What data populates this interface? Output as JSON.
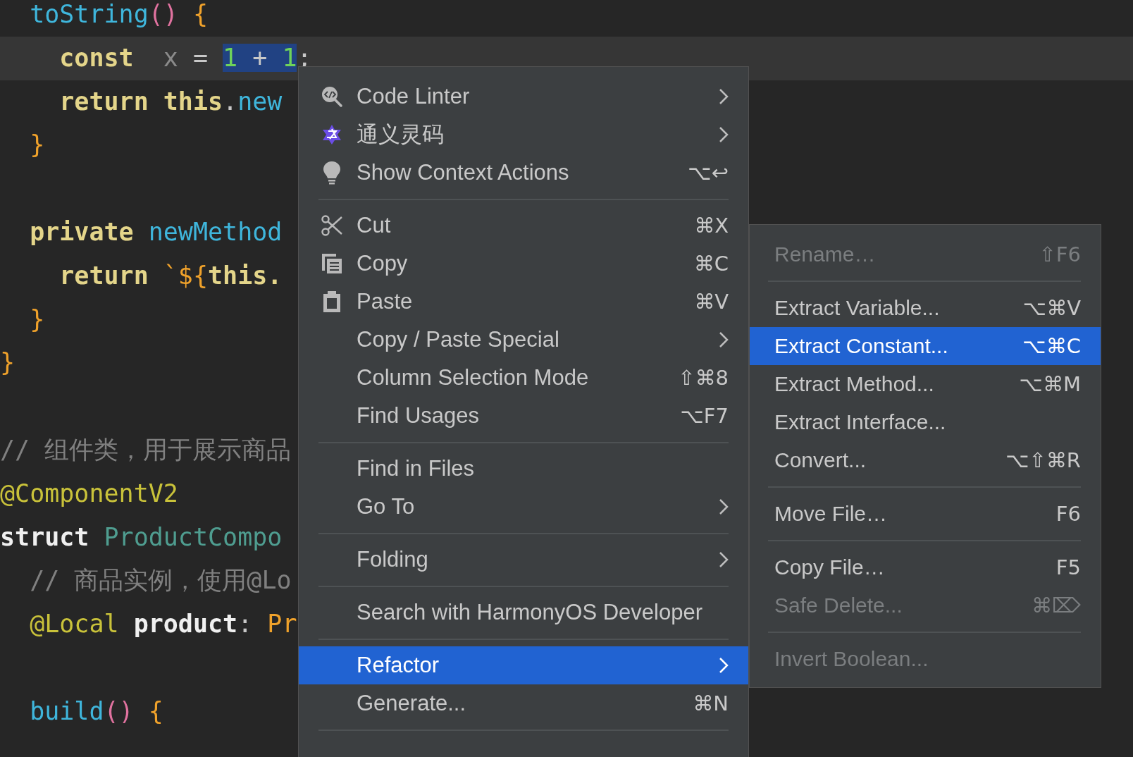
{
  "editor": {
    "lines": [
      {
        "current": false,
        "tokens": [
          {
            "text": "  toString",
            "kind": "function",
            "selected": false
          },
          {
            "text": "()",
            "kind": "paren",
            "selected": false
          },
          {
            "text": " {",
            "kind": "brace",
            "selected": false
          }
        ]
      },
      {
        "current": true,
        "tokens": [
          {
            "text": "    const",
            "kind": "keyword",
            "selected": false
          },
          {
            "text": "  x",
            "kind": "variable",
            "selected": false
          },
          {
            "text": " = ",
            "kind": "operator",
            "selected": false
          },
          {
            "text": "1",
            "kind": "number",
            "selected": true
          },
          {
            "text": " + ",
            "kind": "operator",
            "selected": true
          },
          {
            "text": "1",
            "kind": "number",
            "selected": true
          },
          {
            "text": ";",
            "kind": "operator",
            "selected": false
          }
        ]
      },
      {
        "current": false,
        "tokens": [
          {
            "text": "    return this",
            "kind": "keyword",
            "selected": false
          },
          {
            "text": ".",
            "kind": "operator",
            "selected": false
          },
          {
            "text": "new",
            "kind": "function",
            "selected": false
          }
        ]
      },
      {
        "current": false,
        "tokens": [
          {
            "text": "  }",
            "kind": "brace",
            "selected": false
          }
        ]
      },
      {
        "current": false
      },
      {
        "current": false,
        "tokens": [
          {
            "text": "  private",
            "kind": "keyword",
            "selected": false
          },
          {
            "text": " newMethod",
            "kind": "function",
            "selected": false
          }
        ]
      },
      {
        "current": false,
        "tokens": [
          {
            "text": "    return",
            "kind": "keyword",
            "selected": false
          },
          {
            "text": " `${",
            "kind": "brace",
            "selected": false
          },
          {
            "text": "this.",
            "kind": "keyword",
            "selected": false
          }
        ]
      },
      {
        "current": false,
        "tokens": [
          {
            "text": "  }",
            "kind": "brace",
            "selected": false
          }
        ]
      },
      {
        "current": false,
        "tokens": [
          {
            "text": "}",
            "kind": "brace",
            "selected": false
          }
        ]
      },
      {
        "current": false
      },
      {
        "current": false,
        "tokens": [
          {
            "text": "// 组件类，用于展示商品",
            "kind": "comment",
            "selected": false
          }
        ]
      },
      {
        "current": false,
        "tokens": [
          {
            "text": "@ComponentV2",
            "kind": "annotation",
            "selected": false
          }
        ]
      },
      {
        "current": false,
        "tokens": [
          {
            "text": "struct",
            "kind": "plain",
            "selected": false
          },
          {
            "text": " ProductCompo",
            "kind": "type",
            "selected": false
          }
        ]
      },
      {
        "current": false,
        "tokens": [
          {
            "text": "  // 商品实例，使用@Lo",
            "kind": "comment",
            "selected": false
          }
        ]
      },
      {
        "current": false,
        "tokens": [
          {
            "text": "  @Local",
            "kind": "annotation",
            "selected": false
          },
          {
            "text": " product",
            "kind": "plain",
            "selected": false
          },
          {
            "text": ": ",
            "kind": "operator",
            "selected": false
          },
          {
            "text": "Pr",
            "kind": "brace",
            "selected": false
          }
        ]
      },
      {
        "current": false
      },
      {
        "current": false,
        "tokens": [
          {
            "text": "  build",
            "kind": "function",
            "selected": false
          },
          {
            "text": "()",
            "kind": "paren",
            "selected": false
          },
          {
            "text": " {",
            "kind": "brace",
            "selected": false
          }
        ]
      }
    ]
  },
  "context_menu": {
    "items": [
      {
        "kind": "item",
        "label": "Code Linter",
        "submenu": true,
        "selected": false
      },
      {
        "kind": "item",
        "label": "通义灵码",
        "submenu": true,
        "selected": false
      },
      {
        "kind": "item",
        "label": "Show Context Actions",
        "shortcut": "⌥↩",
        "submenu": false,
        "selected": false
      },
      {
        "kind": "separator"
      },
      {
        "kind": "item",
        "label": "Cut",
        "shortcut": "⌘X",
        "submenu": false,
        "selected": false
      },
      {
        "kind": "item",
        "label": "Copy",
        "shortcut": "⌘C",
        "submenu": false,
        "selected": false
      },
      {
        "kind": "item",
        "label": "Paste",
        "shortcut": "⌘V",
        "submenu": false,
        "selected": false
      },
      {
        "kind": "item",
        "label": "Copy / Paste Special",
        "submenu": true,
        "selected": false
      },
      {
        "kind": "item",
        "label": "Column Selection Mode",
        "shortcut": "⇧⌘8",
        "submenu": false,
        "selected": false
      },
      {
        "kind": "item",
        "label": "Find Usages",
        "shortcut": "⌥F7",
        "submenu": false,
        "selected": false
      },
      {
        "kind": "separator"
      },
      {
        "kind": "item",
        "label": "Find in Files",
        "submenu": false,
        "selected": false
      },
      {
        "kind": "item",
        "label": "Go To",
        "submenu": true,
        "selected": false
      },
      {
        "kind": "separator"
      },
      {
        "kind": "item",
        "label": "Folding",
        "submenu": true,
        "selected": false
      },
      {
        "kind": "separator"
      },
      {
        "kind": "item",
        "label": "Search with HarmonyOS Developer",
        "submenu": false,
        "selected": false
      },
      {
        "kind": "separator"
      },
      {
        "kind": "item",
        "label": "Refactor",
        "submenu": true,
        "selected": true
      },
      {
        "kind": "item",
        "label": "Generate...",
        "shortcut": "⌘N",
        "submenu": false,
        "selected": false
      },
      {
        "kind": "separator"
      }
    ]
  },
  "refactor_submenu": {
    "items": [
      {
        "kind": "item",
        "label": "Rename…",
        "shortcut": "⇧F6",
        "disabled": true,
        "selected": false
      },
      {
        "kind": "separator"
      },
      {
        "kind": "item",
        "label": "Extract Variable...",
        "shortcut": "⌥⌘V",
        "disabled": false,
        "selected": false
      },
      {
        "kind": "item",
        "label": "Extract Constant...",
        "shortcut": "⌥⌘C",
        "disabled": false,
        "selected": true
      },
      {
        "kind": "item",
        "label": "Extract Method...",
        "shortcut": "⌥⌘M",
        "disabled": false,
        "selected": false
      },
      {
        "kind": "item",
        "label": "Extract Interface...",
        "disabled": false,
        "selected": false
      },
      {
        "kind": "item",
        "label": "Convert...",
        "shortcut": "⌥⇧⌘R",
        "disabled": false,
        "selected": false
      },
      {
        "kind": "separator"
      },
      {
        "kind": "item",
        "label": "Move File…",
        "shortcut": "F6",
        "disabled": false,
        "selected": false
      },
      {
        "kind": "separator"
      },
      {
        "kind": "item",
        "label": "Copy File…",
        "shortcut": "F5",
        "disabled": false,
        "selected": false
      },
      {
        "kind": "item",
        "label": "Safe Delete...",
        "shortcut": "⌘⌦",
        "disabled": true,
        "selected": false
      },
      {
        "kind": "separator"
      },
      {
        "kind": "item",
        "label": "Invert Boolean...",
        "disabled": true,
        "selected": false
      }
    ]
  }
}
